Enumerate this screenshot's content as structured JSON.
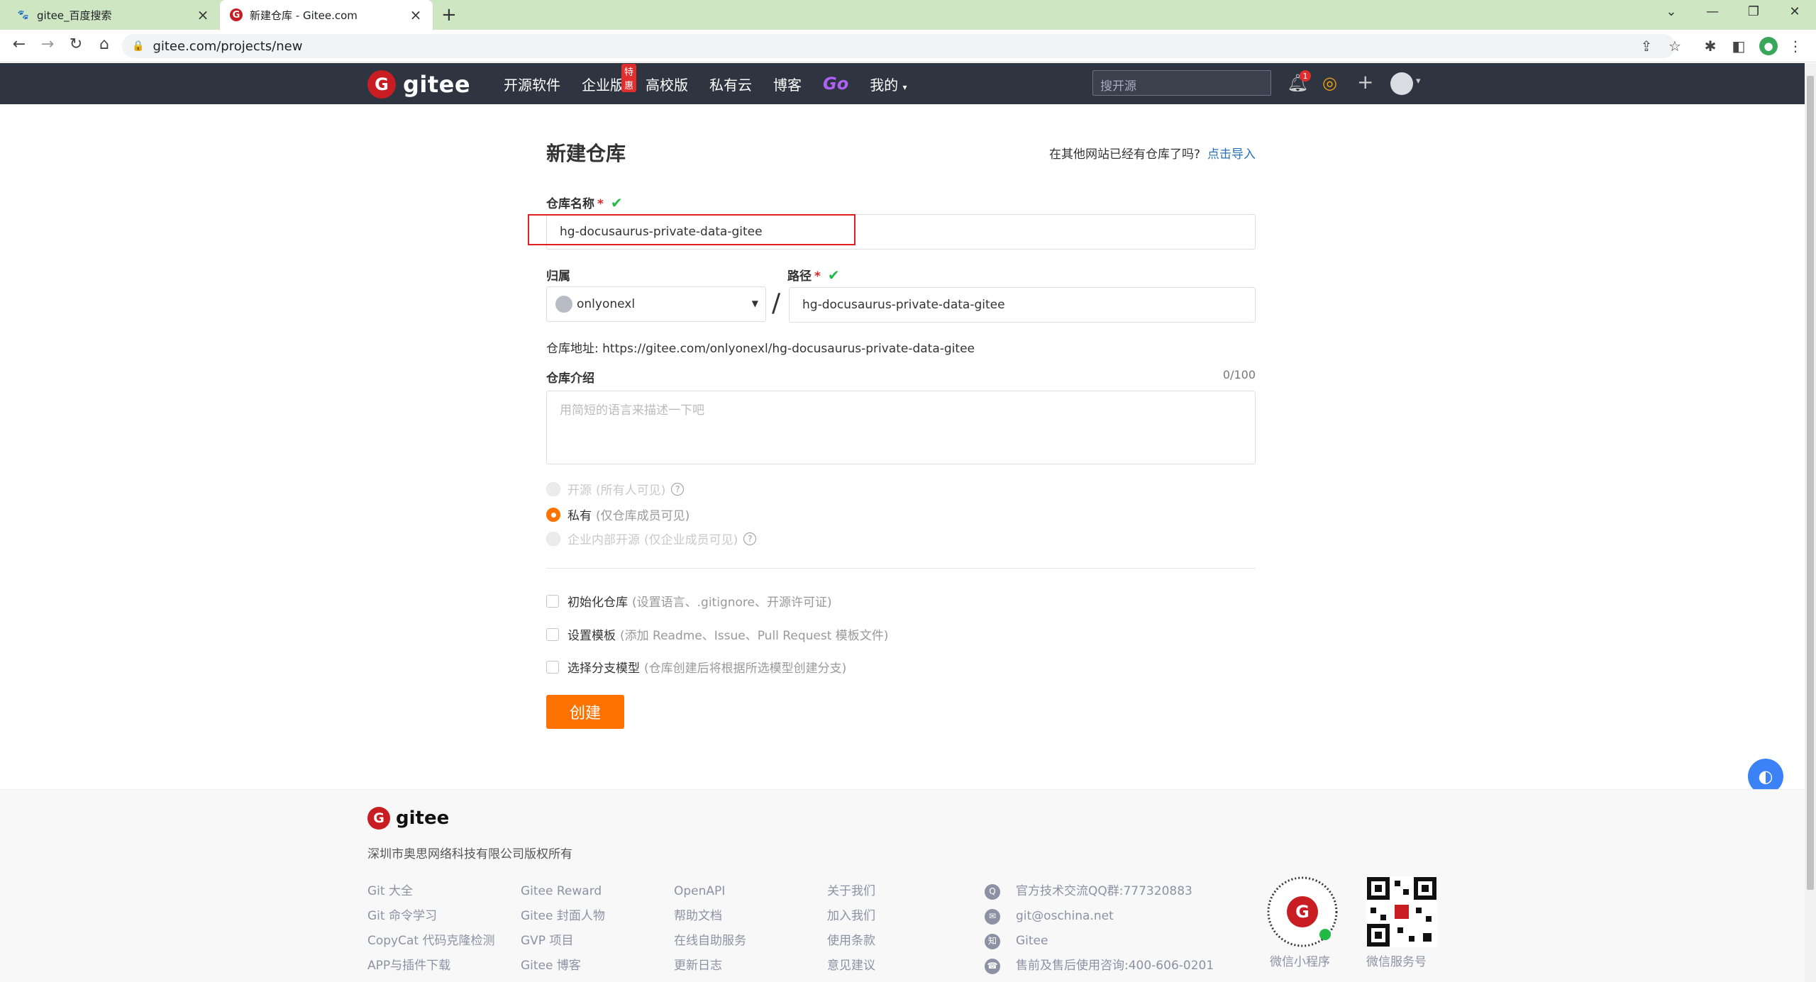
{
  "browser": {
    "tabs": [
      {
        "title": "gitee_百度搜索",
        "active": false
      },
      {
        "title": "新建仓库 - Gitee.com",
        "active": true
      }
    ],
    "url": "gitee.com/projects/new"
  },
  "header": {
    "logo": "gitee",
    "nav": [
      "开源软件",
      "企业版",
      "高校版",
      "私有云",
      "博客",
      "Go",
      "我的"
    ],
    "badge": "特惠",
    "search_placeholder": "搜开源",
    "notif_count": "1"
  },
  "form": {
    "title": "新建仓库",
    "import_prompt": "在其他网站已经有仓库了吗?",
    "import_link": "点击导入",
    "name_label": "仓库名称",
    "name_value": "hg-docusaurus-private-data-gitee",
    "owner_label": "归属",
    "owner_value": "onlyonexl",
    "path_label": "路径",
    "path_value": "hg-docusaurus-private-data-gitee",
    "repo_url": "仓库地址: https://gitee.com/onlyonexl/hg-docusaurus-private-data-gitee",
    "desc_label": "仓库介绍",
    "desc_counter": "0/100",
    "desc_placeholder": "用简短的语言来描述一下吧",
    "visibility": [
      {
        "label": "开源",
        "hint": "(所有人可见)",
        "selected": false,
        "disabled": true
      },
      {
        "label": "私有",
        "hint": "(仅仓库成员可见)",
        "selected": true,
        "disabled": false
      },
      {
        "label": "企业内部开源",
        "hint": "(仅企业成员可见)",
        "selected": false,
        "disabled": true
      }
    ],
    "options": [
      {
        "label": "初始化仓库",
        "hint": "(设置语言、.gitignore、开源许可证)"
      },
      {
        "label": "设置模板",
        "hint": "(添加 Readme、Issue、Pull Request 模板文件)"
      },
      {
        "label": "选择分支模型",
        "hint": "(仓库创建后将根据所选模型创建分支)"
      }
    ],
    "submit": "创建"
  },
  "footer": {
    "logo": "gitee",
    "copyright": "深圳市奥思网络科技有限公司版权所有",
    "col1": [
      "Git 大全",
      "Git 命令学习",
      "CopyCat 代码克隆检测",
      "APP与插件下载"
    ],
    "col2": [
      "Gitee Reward",
      "Gitee 封面人物",
      "GVP 项目",
      "Gitee 博客"
    ],
    "col3": [
      "OpenAPI",
      "帮助文档",
      "在线自助服务",
      "更新日志"
    ],
    "col4": [
      "关于我们",
      "加入我们",
      "使用条款",
      "意见建议"
    ],
    "contact": [
      {
        "icon": "qq-icon",
        "text": "官方技术交流QQ群:777320883"
      },
      {
        "icon": "mail-icon",
        "text": "git@oschina.net"
      },
      {
        "icon": "zhihu-icon",
        "text": "Gitee"
      },
      {
        "icon": "phone-icon",
        "text": "售前及售后使用咨询:400-606-0201"
      }
    ],
    "qr_labels": [
      "微信小程序",
      "微信服务号"
    ]
  },
  "colors": {
    "accent": "#fe7300",
    "header_bg": "#2e3440",
    "brand": "#c71d23",
    "link": "#2a70b8"
  }
}
